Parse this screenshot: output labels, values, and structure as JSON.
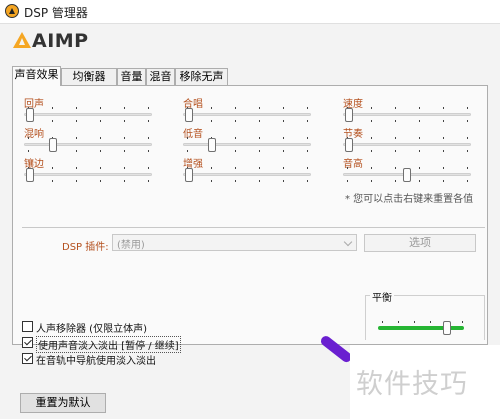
{
  "window": {
    "title": "DSP 管理器"
  },
  "logo": {
    "text": "AIMP"
  },
  "tabs": [
    {
      "label": "声音效果",
      "active": true
    },
    {
      "label": "均衡器",
      "active": false
    },
    {
      "label": "音量",
      "active": false
    },
    {
      "label": "混音",
      "active": false
    },
    {
      "label": "移除无声",
      "active": false
    }
  ],
  "effects": {
    "sliders": [
      {
        "label": "回声",
        "level": 0.0
      },
      {
        "label": "混响",
        "level": 0.2
      },
      {
        "label": "镶边",
        "level": 0.0
      },
      {
        "label": "合唱",
        "level": 0.0
      },
      {
        "label": "低音",
        "level": 0.2
      },
      {
        "label": "增强",
        "level": 0.0
      },
      {
        "label": "速度",
        "level": 0.0
      },
      {
        "label": "节奏",
        "level": 0.0
      },
      {
        "label": "音高",
        "level": 0.5
      }
    ],
    "hint": "* 您可以点击右键来重置各值"
  },
  "dsp": {
    "label": "DSP 插件:",
    "value": "(禁用)",
    "options_button": "选项"
  },
  "checkboxes": [
    {
      "label": "人声移除器 (仅限立体声)",
      "checked": false
    },
    {
      "label": "使用声音淡入淡出 [暂停 / 继续]",
      "checked": true
    },
    {
      "label": "在音轨中导航使用淡入淡出",
      "checked": true
    }
  ],
  "balance": {
    "title": "平衡",
    "level": 0.83
  },
  "reset_button": "重置为默认",
  "watermark": "软件技巧",
  "colors": {
    "accent": "#f5a623",
    "label": "#b4501e",
    "balance": "#25b533",
    "pen": "#6a1fd0"
  }
}
